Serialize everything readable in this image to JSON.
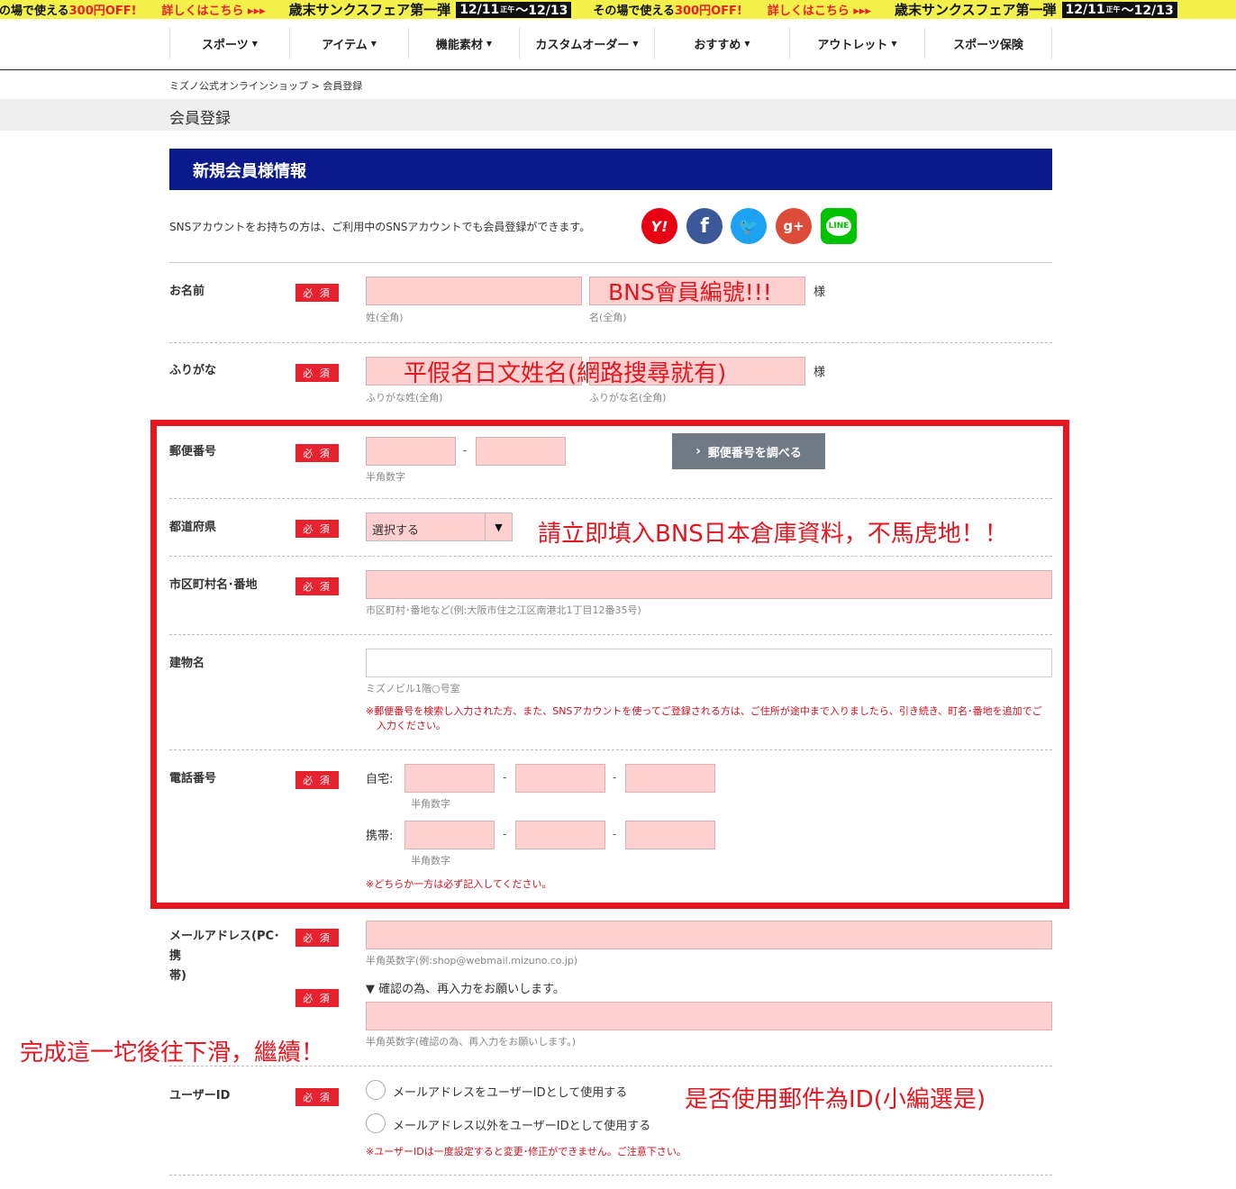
{
  "promo": {
    "offer1": "その場で使える",
    "offer2": "300円OFF!",
    "more": "詳しくはこちら ▸▸▸",
    "title": "歳末サンクスフェア第一弾",
    "date_start": "12/11",
    "date_mid": "正午",
    "date_end": "〜12/13"
  },
  "nav": {
    "items": [
      {
        "label": "スポーツ",
        "caret": "▼"
      },
      {
        "label": "アイテム",
        "caret": "▼"
      },
      {
        "label": "機能素材",
        "caret": "▼"
      },
      {
        "label": "カスタムオーダー",
        "caret": "▼"
      },
      {
        "label": "おすすめ",
        "caret": "▼"
      },
      {
        "label": "アウトレット",
        "caret": "▼"
      },
      {
        "label": "スポーツ保険",
        "caret": ""
      }
    ]
  },
  "breadcrumb": {
    "home": "ミズノ公式オンラインショップ",
    "sep": " > ",
    "current": "会員登録"
  },
  "page_title": "会員登録",
  "section_title": "新規会員様情報",
  "sns": {
    "text": "SNSアカウントをお持ちの方は、ご利用中のSNSアカウントでも会員登録ができます。",
    "yahoo": "Y!",
    "facebook": "f",
    "twitter": "🐦",
    "google": "g+",
    "line": "LINE"
  },
  "required": "必 須",
  "form": {
    "name": {
      "label": "お名前",
      "hint_last": "姓(全角)",
      "hint_first": "名(全角)",
      "suffix": "様"
    },
    "kana": {
      "label": "ふりがな",
      "hint_last": "ふりがな姓(全角)",
      "hint_first": "ふりがな名(全角)",
      "suffix": "様"
    },
    "zip": {
      "label": "郵便番号",
      "sep": "-",
      "hint": "半角数字",
      "button": "郵便番号を調べる",
      "button_icon": "›"
    },
    "pref": {
      "label": "都道府県",
      "value": "選択する",
      "arrow": "▼"
    },
    "city": {
      "label": "市区町村名･番地",
      "hint": "市区町村･番地など(例:大阪市住之江区南港北1丁目12番35号)"
    },
    "building": {
      "label": "建物名",
      "hint": "ミズノビル1階○号室",
      "note_line1": "※郵便番号を検索し入力された方、また、SNSアカウントを使ってご登録される方は、ご住所が途中まで入りましたら、引き続き、町名･番地を追加でご",
      "note_line2": "入力ください。"
    },
    "tel": {
      "label": "電話番号",
      "home_label": "自宅:",
      "mobile_label": "携帯:",
      "sep": "-",
      "hint": "半角数字",
      "note": "※どちらか一方は必ず記入してください。"
    },
    "email": {
      "label_line1": "メールアドレス(PC･携",
      "label_line2": "帯)",
      "hint": "半角英数字(例:shop@webmail.mizuno.co.jp)",
      "confirm_text": "▼ 確認の為、再入力をお願いします。",
      "confirm_hint": "半角英数字(確認の為、再入力をお願いします。)"
    },
    "userid": {
      "label": "ユーザーID",
      "option1": "メールアドレスをユーザーIDとして使用する",
      "option2": "メールアドレス以外をユーザーIDとして使用する",
      "note": "※ユーザーIDは一度設定すると変更･修正ができません。ご注意下さい。"
    }
  },
  "annotations": {
    "name": "BNS會員編號!!!",
    "kana": "平假名日文姓名(網路搜尋就有)",
    "warehouse": "請立即填入BNS日本倉庫資料，不馬虎地！！",
    "scroll": "完成這一坨後往下滑，繼續！",
    "userid": "是否使用郵件為ID(小編選是)"
  },
  "colors": {
    "accent_red": "#e4161f",
    "header_navy": "#0a1a8c",
    "promo_yellow": "#f3f14a",
    "input_pink": "#ffd0d0"
  }
}
